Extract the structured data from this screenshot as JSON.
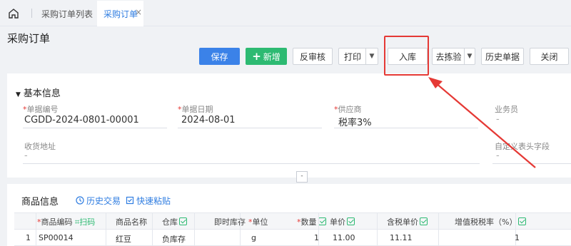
{
  "tabs": {
    "list_label": "采购订单列表",
    "active_label": "采购订单",
    "close_glyph": "×"
  },
  "page": {
    "title": "采购订单"
  },
  "toolbar": {
    "save": "保存",
    "add": "新增",
    "unaudit": "反审核",
    "print": "打印",
    "stock_in": "入库",
    "inspect": "去拣验",
    "history": "历史单据",
    "close": "关闭"
  },
  "basic": {
    "title": "基本信息",
    "fields": {
      "doc_no": {
        "label": "单据编号",
        "value": "CGDD-2024-0801-00001",
        "required": true
      },
      "doc_date": {
        "label": "单据日期",
        "value": "2024-08-01",
        "required": true
      },
      "supplier": {
        "label": "供应商",
        "value": "税率3%",
        "required": true
      },
      "salesman": {
        "label": "业务员",
        "value": "-"
      },
      "address": {
        "label": "收货地址",
        "value": "-"
      },
      "custom": {
        "label": "自定义表头字段",
        "value": "-"
      }
    },
    "collapse": "-"
  },
  "products": {
    "title": "商品信息",
    "history_trade": "历史交易",
    "quick_paste": "快速粘贴",
    "scan": "扫码",
    "columns": [
      "商品编码",
      "商品名称",
      "仓库",
      "即时库存",
      "单位",
      "数量",
      "单价",
      "含税单价",
      "增值税税率（%）"
    ],
    "rows": [
      {
        "index": "1",
        "code": "SP00014",
        "name": "红豆",
        "warehouse": "负库存",
        "stock": "",
        "unit": "g",
        "qty": "1",
        "price": "11.00",
        "tax_price": "11.11",
        "tax_rate": "1"
      }
    ]
  },
  "colors": {
    "primary": "#3b82e8",
    "success": "#2dba72",
    "highlight": "#e53935"
  },
  "icons": [
    "home-icon",
    "plus-icon",
    "chevron-down-icon",
    "clock-icon",
    "paste-icon",
    "scan-icon",
    "checkbox-icon"
  ]
}
